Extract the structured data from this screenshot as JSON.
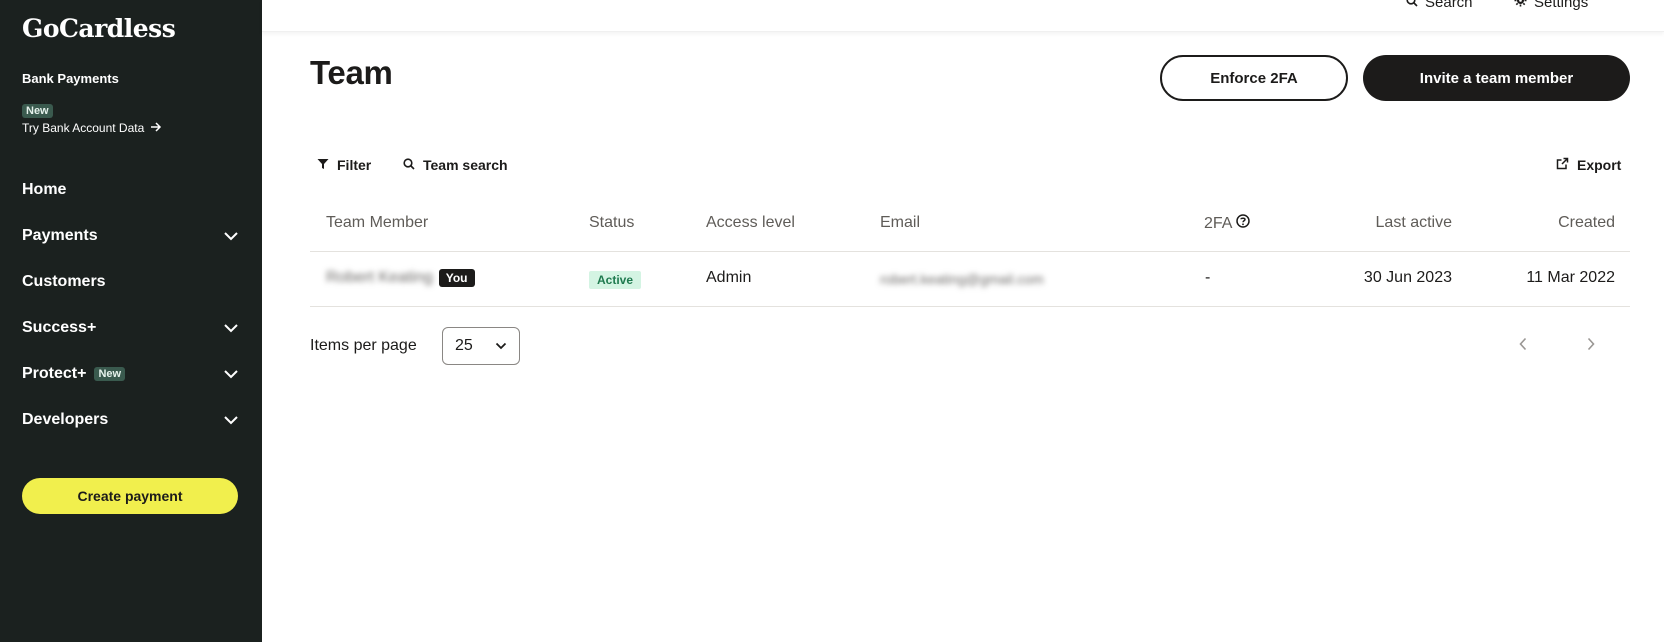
{
  "sidebar": {
    "logo": "GoCardless",
    "bank_payments": {
      "title": "Bank Payments",
      "badge": "New",
      "link": "Try Bank Account Data"
    },
    "nav": [
      {
        "label": "Home"
      },
      {
        "label": "Payments"
      },
      {
        "label": "Customers"
      },
      {
        "label": "Success+"
      },
      {
        "label": "Protect+",
        "badge": "New"
      },
      {
        "label": "Developers"
      }
    ],
    "create_button": "Create payment"
  },
  "topbar": {
    "search": "Search",
    "settings": "Settings"
  },
  "main": {
    "title": "Team",
    "enforce_button": "Enforce 2FA",
    "invite_button": "Invite a team member",
    "toolbar": {
      "filter": "Filter",
      "team_search": "Team search",
      "export": "Export"
    },
    "table": {
      "columns": [
        "Team Member",
        "Status",
        "Access level",
        "Email",
        "2FA",
        "Last active",
        "Created"
      ],
      "rows": [
        {
          "member": "Robert Keating",
          "you_badge": "You",
          "status": "Active",
          "access_level": "Admin",
          "email": "robert.keating@gmail.com",
          "twofa": "-",
          "last_active": "30 Jun 2023",
          "created": "11 Mar 2022"
        }
      ]
    },
    "pagination": {
      "items_per_page_label": "Items per page",
      "items_per_page_value": "25"
    }
  },
  "colors": {
    "sidebar_bg": "#1b211f",
    "accent_yellow": "#f1ef4d",
    "dark_button": "#1c1b1a",
    "active_green_bg": "#d4f4e3",
    "active_green_text": "#1f7a4f"
  },
  "icons": [
    "arrow-right-icon",
    "chevron-down-icon",
    "search-icon",
    "gear-icon",
    "filter-icon",
    "external-link-icon",
    "help-circle-icon",
    "chevron-left-icon",
    "chevron-right-icon"
  ]
}
